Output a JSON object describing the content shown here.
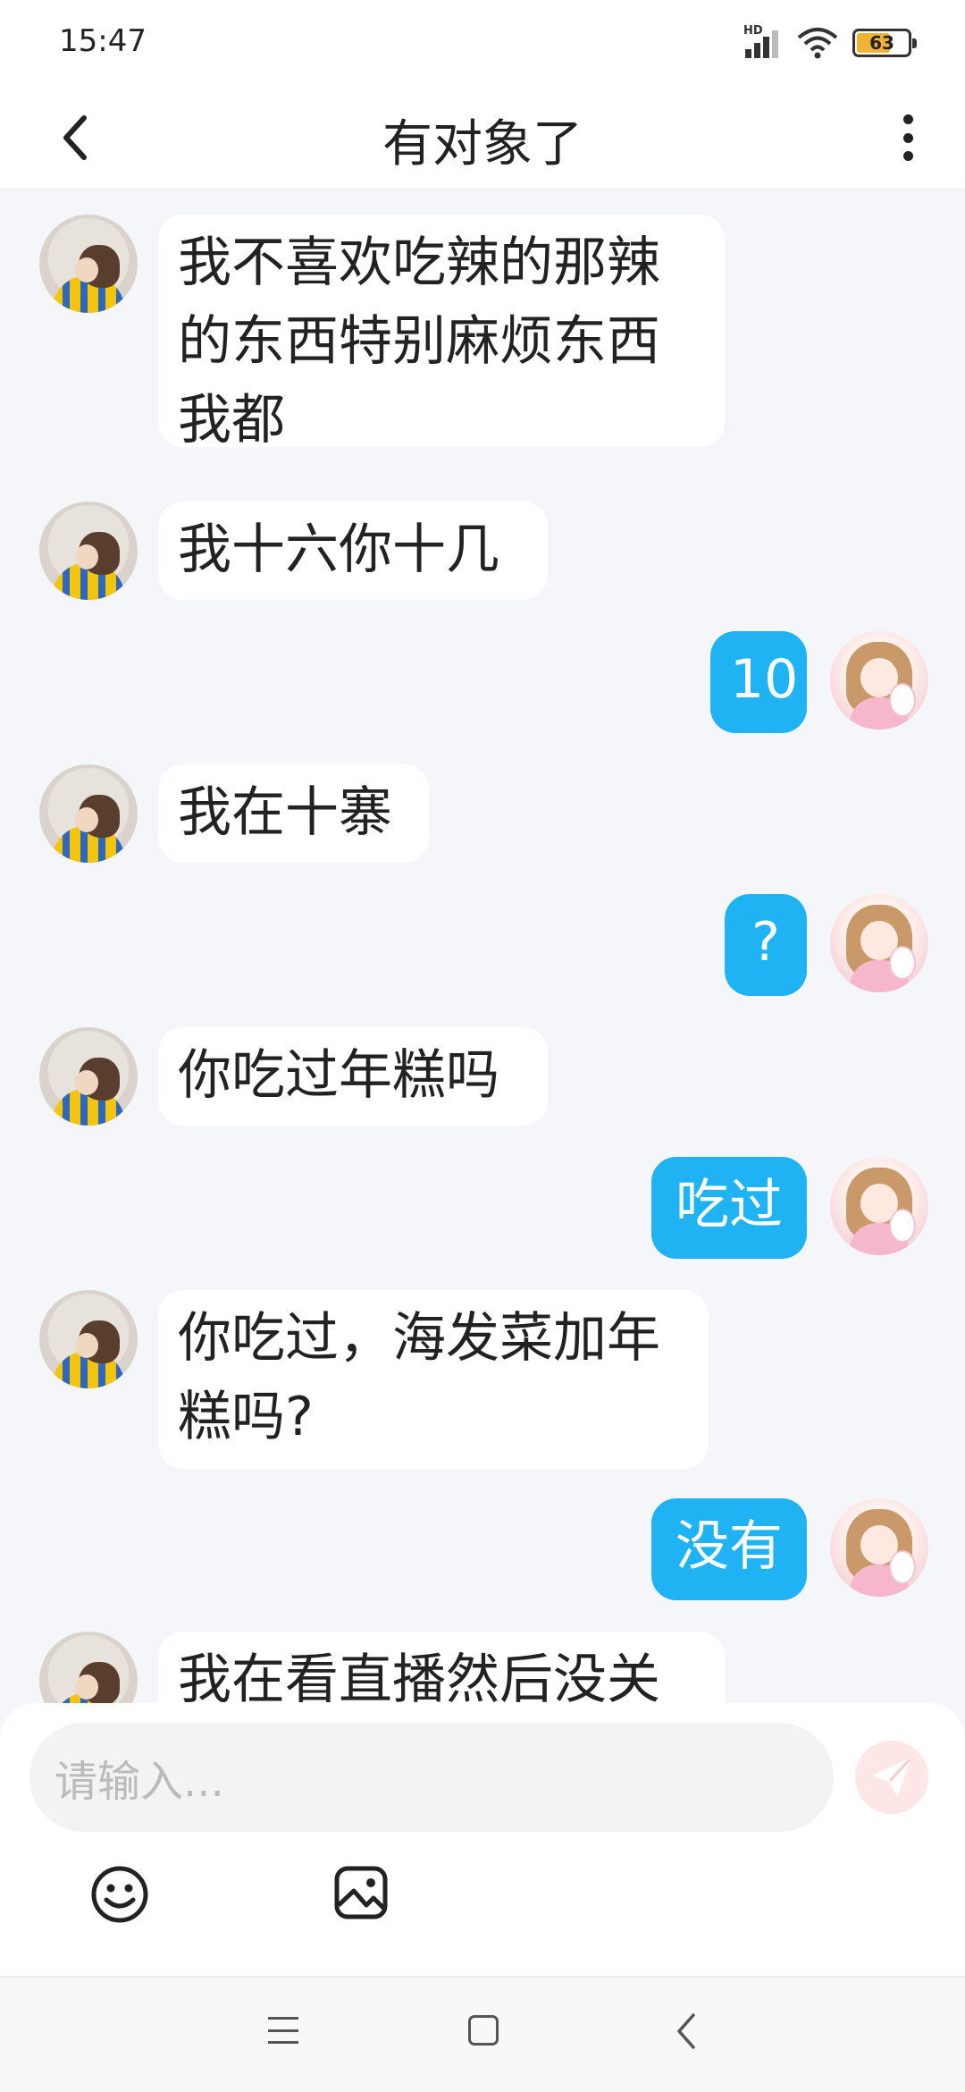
{
  "status_bar": {
    "time": "15:47",
    "network_label": "HD",
    "battery_level": "63",
    "icons": [
      "signal-icon",
      "wifi-icon",
      "battery-icon"
    ]
  },
  "header": {
    "title": "有对象了",
    "back_icon": "chevron-left-icon",
    "more_icon": "more-vertical-icon"
  },
  "messages": [
    {
      "side": "left",
      "text": "我不喜欢吃辣的那辣\n的东西特别麻烦东西\n我都"
    },
    {
      "side": "left",
      "text": "我十六你十几"
    },
    {
      "side": "right",
      "text": "10"
    },
    {
      "side": "left",
      "text": "我在十寨"
    },
    {
      "side": "right",
      "text": "?"
    },
    {
      "side": "left",
      "text": "你吃过年糕吗"
    },
    {
      "side": "right",
      "text": "吃过"
    },
    {
      "side": "left",
      "text": "你吃过，海发菜加年\n糕吗?"
    },
    {
      "side": "right",
      "text": "没有"
    },
    {
      "side": "left",
      "text": "我在看直播然后没关"
    }
  ],
  "composer": {
    "placeholder": "请输入...",
    "send_icon": "send-icon",
    "emoji_icon": "emoji-icon",
    "image_icon": "image-icon"
  },
  "nav_bar": {
    "icons": [
      "menu-icon",
      "home-icon",
      "back-icon"
    ]
  },
  "colors": {
    "accent": "#1fb3f4",
    "background": "#f4f6f9",
    "bubble_left": "#ffffff",
    "send_button": "#fde6e6"
  }
}
